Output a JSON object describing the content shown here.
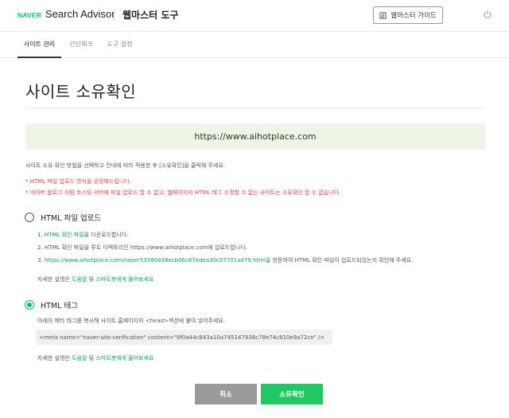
{
  "header": {
    "naver_logo": "NAVER",
    "product_name": "Search Advisor",
    "tool_name": "웹마스터 도구",
    "guide_button": "웹마스터 가이드",
    "guide_icon": "book-icon",
    "power_icon": "power-icon"
  },
  "tabs": [
    {
      "label": "사이트 관리",
      "active": true
    },
    {
      "label": "간단체크",
      "active": false
    },
    {
      "label": "도구 설정",
      "active": false
    }
  ],
  "page": {
    "title": "사이트 소유확인",
    "site_url": "https://www.aihotplace.com",
    "description": "사이트 소유 확인 방법을 선택하고 안내에 따라 적용한 후 [소유확인]을 클릭해 주세요.",
    "note_1": "* HTML 파일 업로드 방식을 권장해드립니다.",
    "note_2": "* 네이버 블로그 처럼 호스팅 서버에 파일 업로드 할 수 없고, 웹페이지의 HTML 태그 수정할 수 없는 사이트는 소유확인 할 수 없습니다."
  },
  "file_upload": {
    "label": "HTML 파일 업로드",
    "selected": false,
    "step_1_prefix": "1. ",
    "step_1_link": "HTML 확인 파일",
    "step_1_suffix": "을 다운로드합니다.",
    "step_2": "2. HTML 확인 파일을 루트 디렉토리인 https://www.aihotplace.com에 업로드합니다.",
    "step_3_prefix": "3. ",
    "step_3_link": "https://www.aihotplace.com/naver53580438ecb06c67edea30c57701ad79.html",
    "step_3_suffix": "을 방문하여 HTML 확인 파일이 업로드되었는지 확인해 주세요.",
    "help_prefix": "자세한 설명은 ",
    "help_link_1": "도움말",
    "help_mid": " 및 ",
    "help_link_2": "스마트봇에게 물어보세요"
  },
  "html_tag": {
    "label": "HTML 태그",
    "selected": true,
    "description": "아래의 메타 태그를 복사해 사이트 홈페이지의 <head>섹션에 붙여 넣어주세요.",
    "meta_code": "<meta name=\"naver-site-verification\" content=\"8f0a44c643a10a745147938c78e74c810e9a72ce\" />",
    "help_prefix": "자세한 설명은 ",
    "help_link_1": "도움말",
    "help_mid": " 및 ",
    "help_link_2": "스마트봇에게 물어보세요"
  },
  "buttons": {
    "cancel": "취소",
    "confirm": "소유확인"
  },
  "colors": {
    "brand_green": "#03c75a",
    "link_green": "#03a94f",
    "note_red": "#e0423c",
    "url_box_bg": "#eef4e6",
    "cancel_gray": "#9a9a9a"
  }
}
